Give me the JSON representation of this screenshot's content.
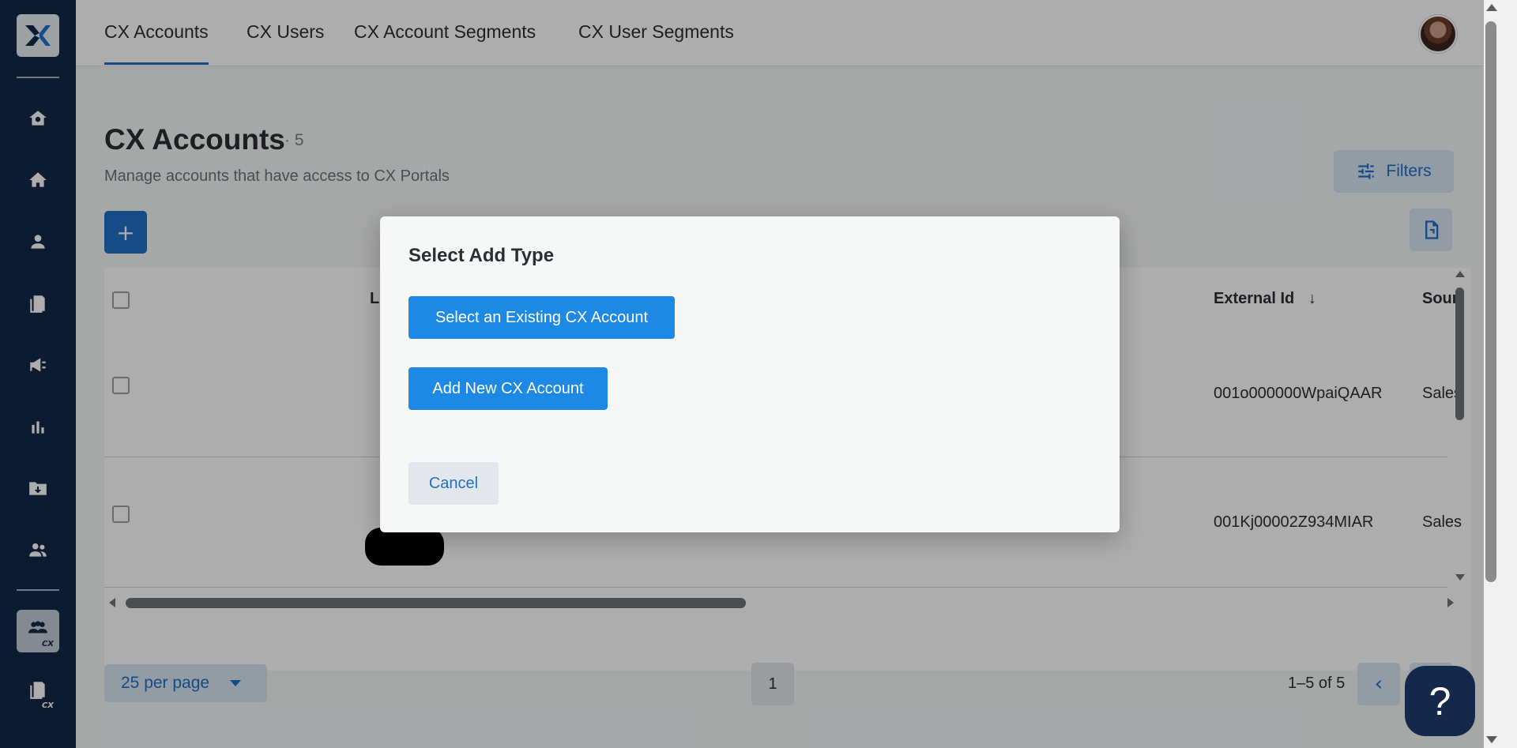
{
  "tabs": [
    {
      "label": "CX Accounts",
      "active": true
    },
    {
      "label": "CX Users"
    },
    {
      "label": "CX Account Segments"
    },
    {
      "label": "CX User Segments"
    }
  ],
  "sidebar": {
    "items": [
      {
        "icon": "home-gear-icon"
      },
      {
        "icon": "home-icon"
      },
      {
        "icon": "person-icon"
      },
      {
        "icon": "document-icon"
      },
      {
        "icon": "megaphone-icon"
      },
      {
        "icon": "bar-chart-icon"
      },
      {
        "icon": "folder-download-icon"
      },
      {
        "icon": "people-icon"
      },
      {
        "icon": "cx-people-icon",
        "badge": "CX",
        "active": true
      },
      {
        "icon": "cx-document-icon",
        "badge": "CX"
      }
    ]
  },
  "page": {
    "title": "CX Accounts",
    "count": "· 5",
    "subtitle": "Manage accounts that have access to CX Portals",
    "filters_label": "Filters",
    "add_label": "+"
  },
  "table": {
    "columns": [
      "L",
      "External Id",
      "Sour"
    ],
    "rows": [
      {
        "external_id": "001o000000WpaiQAAR",
        "source": "Sales"
      },
      {
        "external_id": "001Kj00002Z934MIAR",
        "source": "Sales"
      }
    ]
  },
  "pagination": {
    "per_page": "25 per page",
    "current_page": "1",
    "range": "1–5 of 5"
  },
  "help_label": "?",
  "modal": {
    "title": "Select Add Type",
    "option_existing": "Select an Existing CX Account",
    "option_new": "Add New CX Account",
    "cancel": "Cancel"
  },
  "colors": {
    "sidebar": "#14294a",
    "accent": "#1f6fc6",
    "modal_button": "#1e88e5"
  }
}
